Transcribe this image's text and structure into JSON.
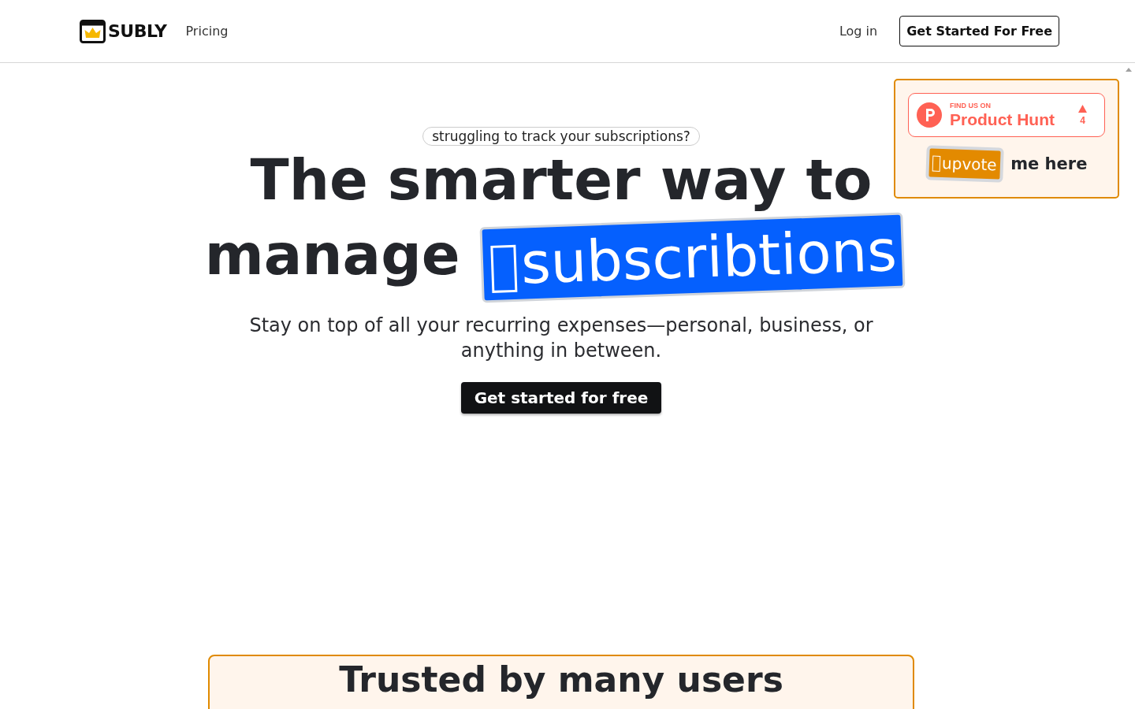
{
  "header": {
    "logo": "SUBLY",
    "nav": [
      "Pricing"
    ],
    "login": "Log in",
    "cta": "Get Started For Free"
  },
  "hero": {
    "eyebrow": "struggling to track your subscriptions?",
    "title_line1": "The smarter way to",
    "title_line2": "manage",
    "highlight": "subscribtions",
    "subtitle": "Stay on top of all your recurring expenses—personal, business, or anything in between.",
    "button": "Get started for free"
  },
  "product_hunt": {
    "kicker": "FIND US ON",
    "name": "Product Hunt",
    "votes": "4",
    "upvote": "upvote",
    "upvote_suffix": "me here"
  },
  "trusted": {
    "title": "Trusted by many users"
  }
}
